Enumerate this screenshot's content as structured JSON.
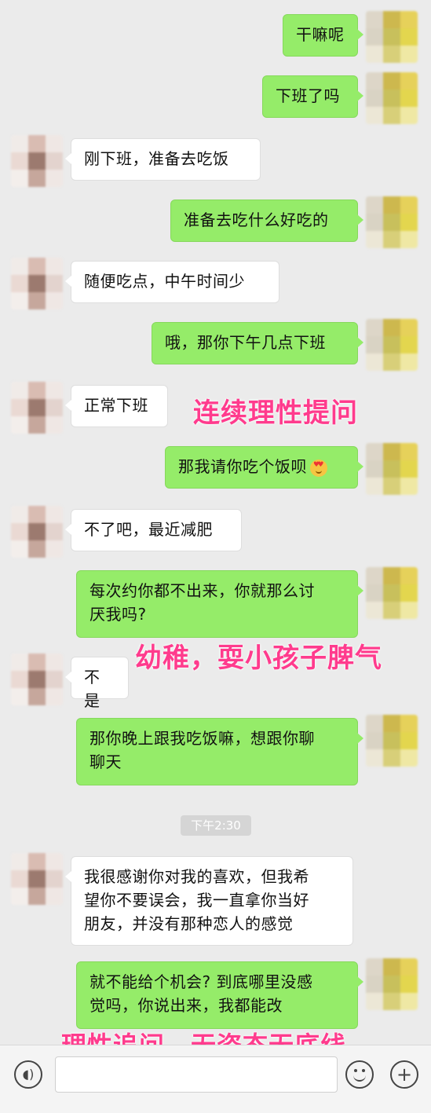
{
  "messages": [
    {
      "side": "me",
      "text": "干嘛呢"
    },
    {
      "side": "me",
      "text": "下班了吗"
    },
    {
      "side": "other",
      "text": "刚下班，准备去吃饭"
    },
    {
      "side": "me",
      "text": "准备去吃什么好吃的"
    },
    {
      "side": "other",
      "text": "随便吃点，中午时间少"
    },
    {
      "side": "me",
      "text": "哦，那你下午几点下班"
    },
    {
      "side": "other",
      "text": "正常下班"
    },
    {
      "side": "me",
      "text": "那我请你吃个饭呗"
    },
    {
      "side": "other",
      "text": "不了吧，最近减肥"
    },
    {
      "side": "me",
      "text": "每次约你都不出来，你就那么讨\n厌我吗?"
    },
    {
      "side": "other",
      "text": "不是"
    },
    {
      "side": "me",
      "text": "那你晚上跟我吃饭嘛，想跟你聊\n聊天"
    },
    {
      "side": "other",
      "text": "我很感谢你对我的喜欢，但我希\n望你不要误会，我一直拿你当好\n朋友，并没有那种恋人的感觉"
    },
    {
      "side": "me",
      "text": "就不能给个机会? 到底哪里没感\n觉吗，你说出来，我都能改"
    }
  ],
  "timestamp": "下午2:30",
  "annotations": {
    "a1": "连续理性提问",
    "a2": "幼稚，耍小孩子脾气",
    "a3": "理性追问，无姿态无底线"
  },
  "emoji": "heart-eyes-emoji",
  "colors": {
    "background": "#ebebeb",
    "my_bubble": "#95ec69",
    "other_bubble": "#ffffff",
    "annotation": "#ff3b8d"
  },
  "bottom_bar": {
    "voice_icon": "voice-icon",
    "emoji_icon": "smile-icon",
    "add_icon": "plus-icon"
  }
}
